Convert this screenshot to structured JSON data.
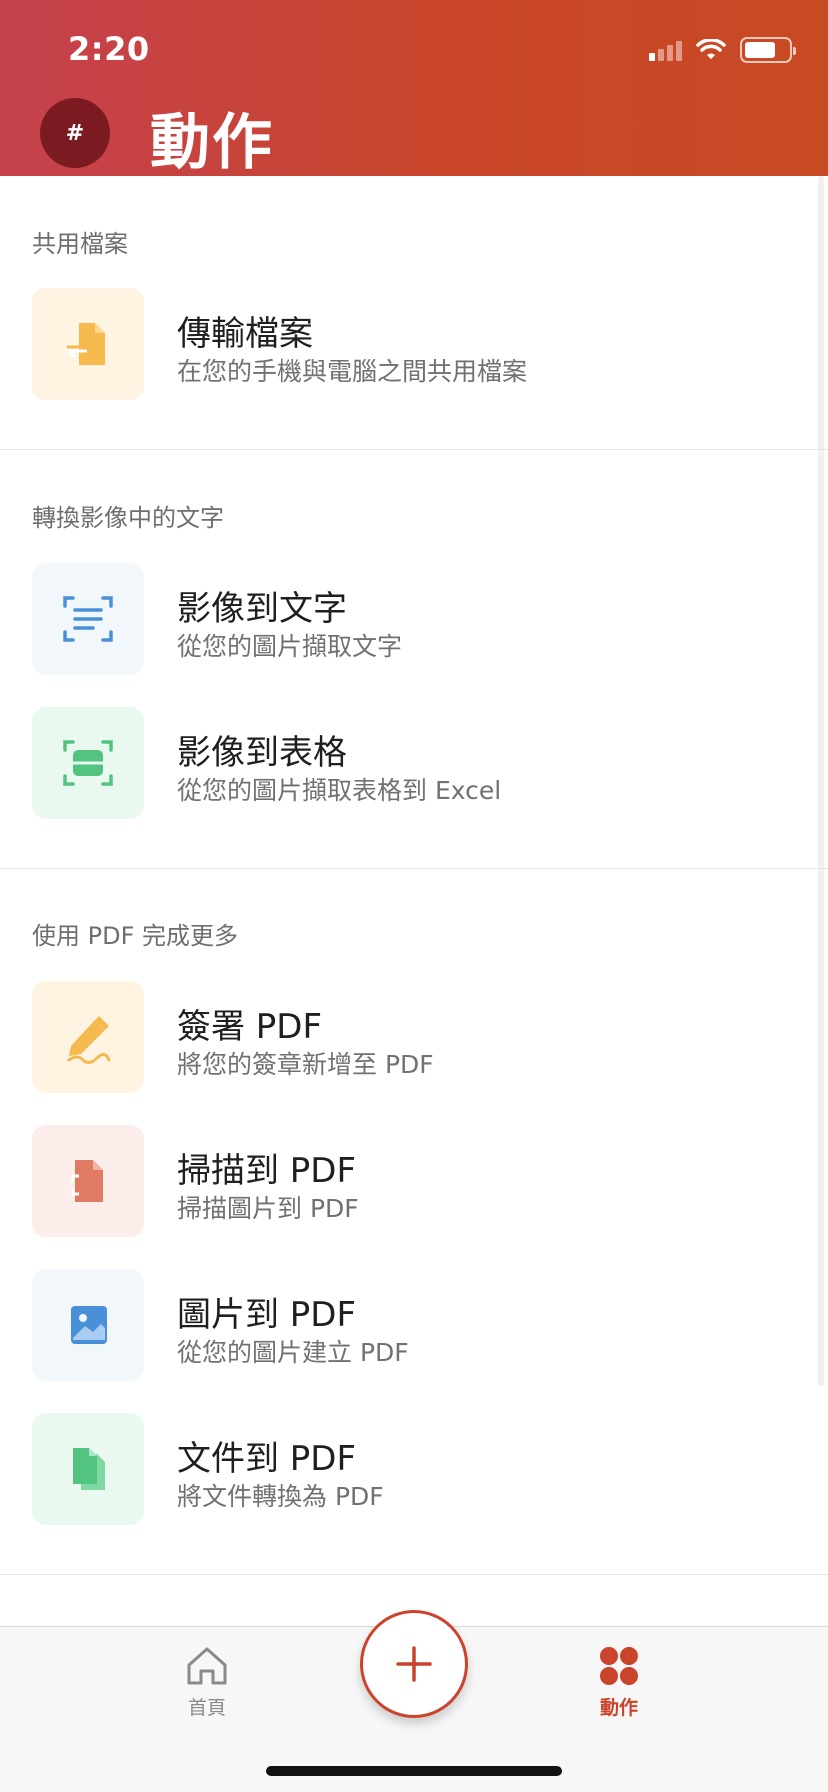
{
  "status_bar": {
    "time": "2:20"
  },
  "header": {
    "avatar_text": "#",
    "title": "動作"
  },
  "sections": [
    {
      "title": "共用檔案",
      "items": [
        {
          "title": "傳輸檔案",
          "subtitle": "在您的手機與電腦之間共用檔案",
          "icon": "file-transfer-icon",
          "tile_color": "#fff4e2",
          "icon_color": "#f5b94e"
        }
      ]
    },
    {
      "title": "轉換影像中的文字",
      "items": [
        {
          "title": "影像到文字",
          "subtitle": "從您的圖片擷取文字",
          "icon": "scan-text-icon",
          "tile_color": "#f1f7fb",
          "icon_color": "#4a90d9"
        },
        {
          "title": "影像到表格",
          "subtitle": "從您的圖片擷取表格到 Excel",
          "icon": "scan-table-icon",
          "tile_color": "#eaf9f0",
          "icon_color": "#52c47f"
        }
      ]
    },
    {
      "title": "使用 PDF 完成更多",
      "items": [
        {
          "title": "簽署 PDF",
          "subtitle": "將您的簽章新增至 PDF",
          "icon": "sign-pen-icon",
          "tile_color": "#fff4e2",
          "icon_color": "#f5b94e"
        },
        {
          "title": "掃描到 PDF",
          "subtitle": "掃描圖片到 PDF",
          "icon": "scan-document-icon",
          "tile_color": "#fbeeea",
          "icon_color": "#e07a62"
        },
        {
          "title": "圖片到 PDF",
          "subtitle": "從您的圖片建立 PDF",
          "icon": "picture-icon",
          "tile_color": "#f1f7fb",
          "icon_color": "#4a90d9"
        },
        {
          "title": "文件到 PDF",
          "subtitle": "將文件轉換為 PDF",
          "icon": "documents-icon",
          "tile_color": "#eaf9f0",
          "icon_color": "#52c47f"
        }
      ]
    }
  ],
  "bottom_nav": {
    "home_label": "首頁",
    "actions_label": "動作",
    "accent_color": "#c9442a"
  }
}
